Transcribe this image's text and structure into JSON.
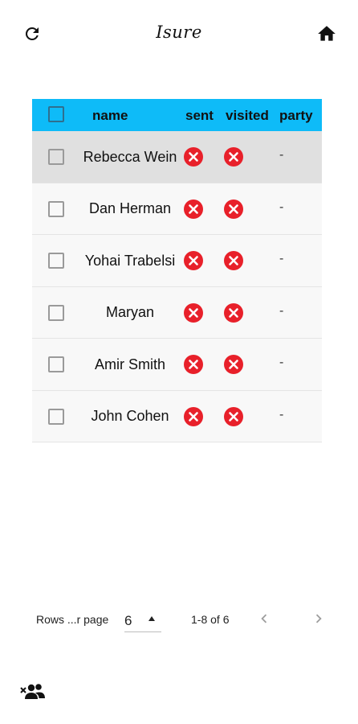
{
  "header": {
    "title": "Isure",
    "refresh_icon": "refresh-icon",
    "home_icon": "home-icon"
  },
  "table": {
    "columns": [
      "name",
      "sent",
      "visited",
      "party"
    ],
    "rows": [
      {
        "name": "Rebecca Wein",
        "sent": false,
        "visited": false,
        "party": "-",
        "selected": true
      },
      {
        "name": "Dan Herman",
        "sent": false,
        "visited": false,
        "party": "-",
        "selected": false
      },
      {
        "name": "Yohai Trabelsi",
        "sent": false,
        "visited": false,
        "party": "-",
        "selected": false
      },
      {
        "name": "Maryan",
        "sent": false,
        "visited": false,
        "party": "-",
        "selected": false
      },
      {
        "name": "Amir Smith",
        "sent": false,
        "visited": false,
        "party": "-",
        "selected": false
      },
      {
        "name": "John Cohen",
        "sent": false,
        "visited": false,
        "party": "-",
        "selected": false
      }
    ],
    "status_icon": "cancel-circle-icon"
  },
  "pagination": {
    "rows_per_page_label": "Rows ...r page",
    "rows_per_page_value": "6",
    "range": "1-8 of 6",
    "prev_icon": "chevron-left-icon",
    "next_icon": "chevron-right-icon"
  },
  "footer": {
    "remove_users_icon": "remove-users-icon"
  },
  "colors": {
    "header_bg": "#0ebbf8",
    "status_red": "#e8202a",
    "selected_row": "#e0e0e0",
    "row_bg": "#f8f8f8"
  }
}
